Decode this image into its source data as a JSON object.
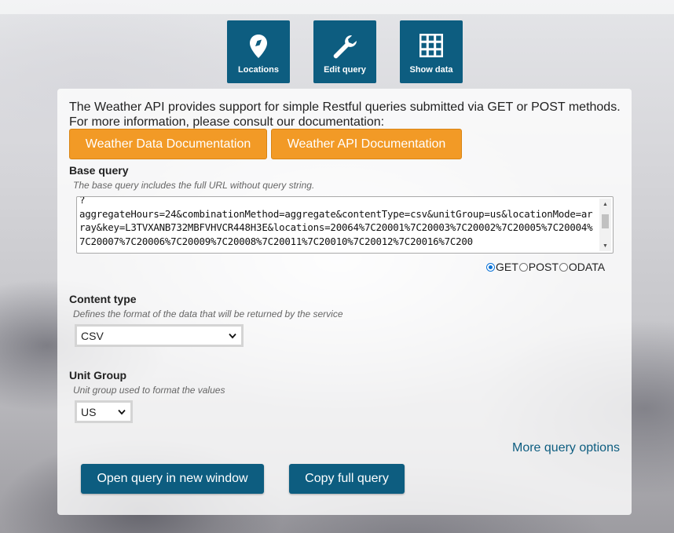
{
  "nav": {
    "locations_label": "Locations",
    "edit_query_label": "Edit query",
    "show_data_label": "Show data"
  },
  "intro": {
    "text": "The Weather API provides support for simple Restful queries submitted via GET or POST methods. For more information, please consult our documentation:"
  },
  "docs": {
    "weather_data_label": "Weather Data Documentation",
    "weather_api_label": "Weather API Documentation"
  },
  "base_query": {
    "title": "Base query",
    "description": "The base query includes the full URL without query string.",
    "value": "?\naggregateHours=24&combinationMethod=aggregate&contentType=csv&unitGroup=us&locationMode=array&key=L3TVXANB732MBFVHVCR448H3E&locations=20064%7C20001%7C20003%7C20002%7C20005%7C20004%7C20007%7C20006%7C20009%7C20008%7C20011%7C20010%7C20012%7C20016%7C200"
  },
  "method": {
    "options": [
      "GET",
      "POST",
      "ODATA"
    ],
    "selected": "GET"
  },
  "content_type": {
    "title": "Content type",
    "description": "Defines the format of the data that will be returned by the service",
    "value": "CSV"
  },
  "unit_group": {
    "title": "Unit Group",
    "description": "Unit group used to format the values",
    "value": "US"
  },
  "more_options_label": "More query options",
  "actions": {
    "open_new_window_label": "Open query in new window",
    "copy_full_query_label": "Copy full query"
  },
  "colors": {
    "primary": "#0d5d80",
    "accent": "#f29a26"
  }
}
